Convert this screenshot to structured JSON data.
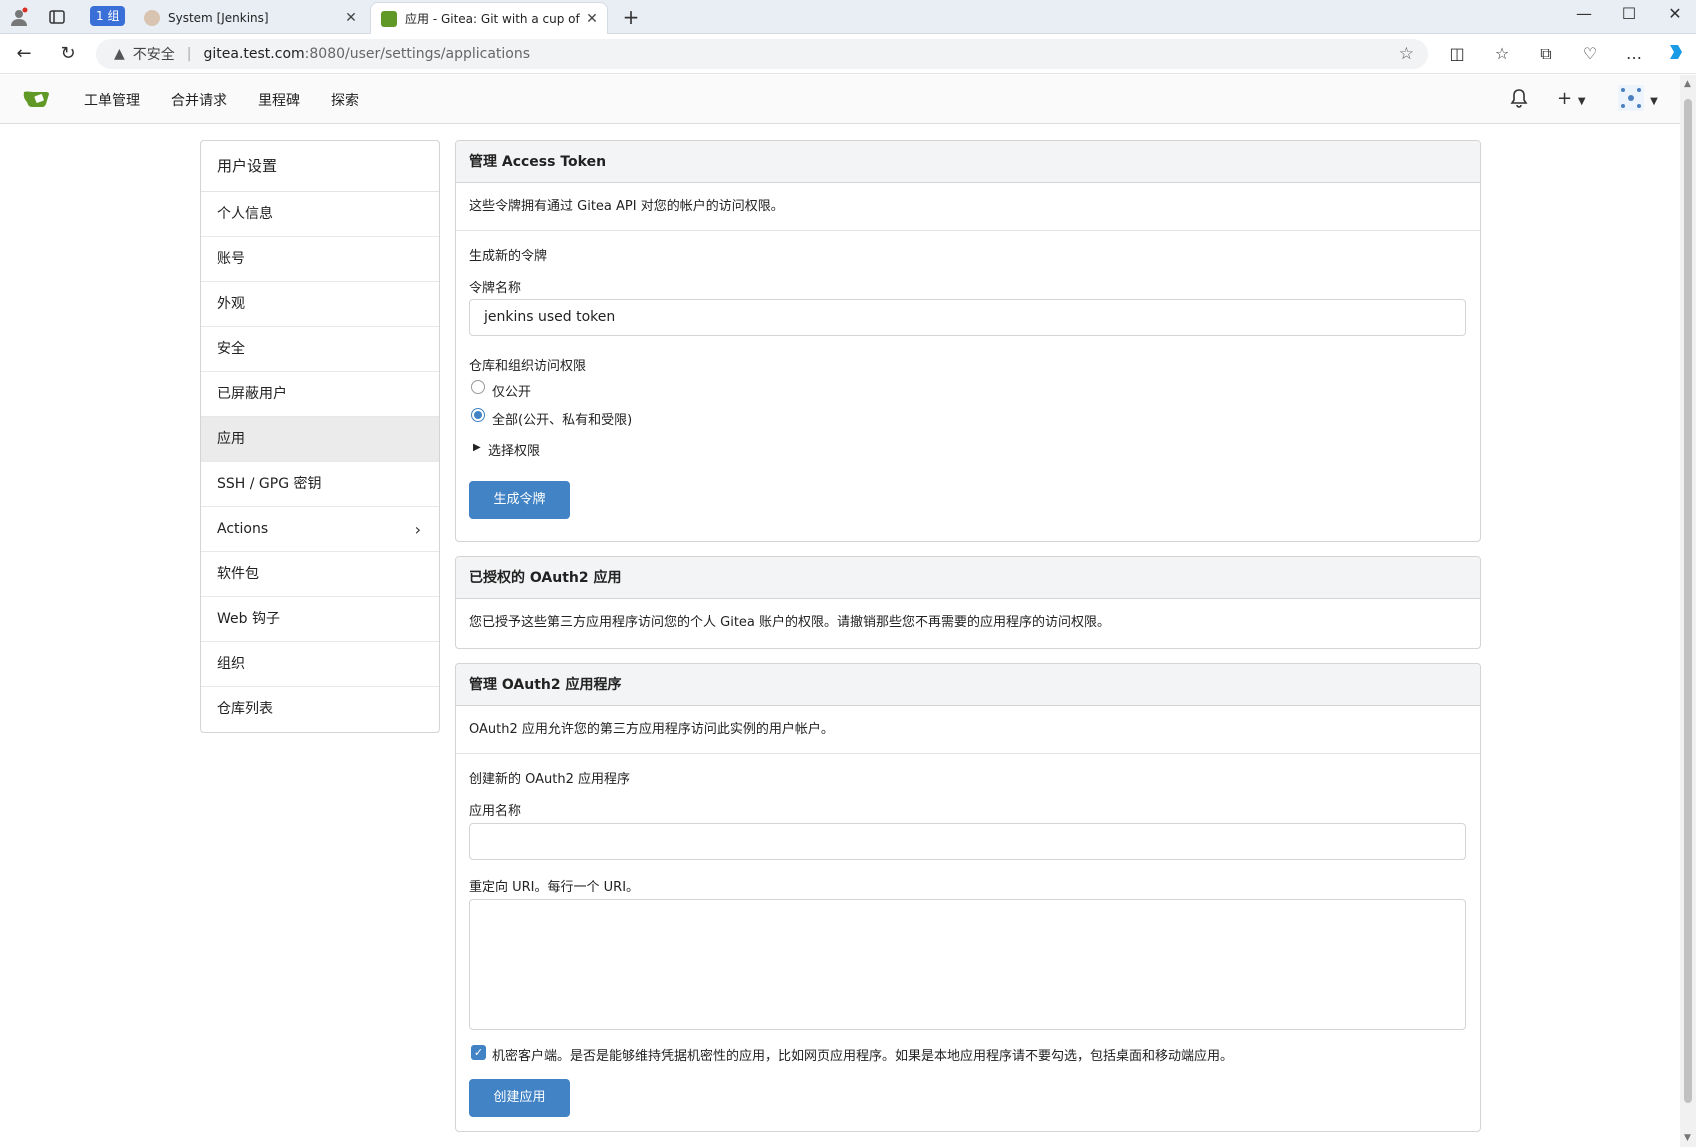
{
  "browser": {
    "group_label": "1 组",
    "tabs": [
      {
        "title": "System [Jenkins]"
      },
      {
        "title": "应用 - Gitea: Git with a cup of tea"
      }
    ],
    "address": {
      "security_label": "不安全",
      "host": "gitea.test.com",
      "path": ":8080/user/settings/applications"
    }
  },
  "navbar": {
    "items": [
      "工单管理",
      "合并请求",
      "里程碑",
      "探索"
    ]
  },
  "sidebar": {
    "header": "用户设置",
    "items": [
      {
        "label": "个人信息"
      },
      {
        "label": "账号"
      },
      {
        "label": "外观"
      },
      {
        "label": "安全"
      },
      {
        "label": "已屏蔽用户"
      },
      {
        "label": "应用",
        "active": true
      },
      {
        "label": "SSH / GPG 密钥"
      },
      {
        "label": "Actions"
      },
      {
        "label": "软件包"
      },
      {
        "label": "Web 钩子"
      },
      {
        "label": "组织"
      },
      {
        "label": "仓库列表"
      }
    ]
  },
  "access_token": {
    "title": "管理 Access Token",
    "description": "这些令牌拥有通过 Gitea API 对您的帐户的访问权限。",
    "generate_heading": "生成新的令牌",
    "name_label": "令牌名称",
    "name_value": "jenkins used token",
    "scope_label": "仓库和组织访问权限",
    "scope_options": [
      "仅公开",
      "全部(公开、私有和受限)"
    ],
    "scope_selected": "全部(公开、私有和受限)",
    "select_permissions": "选择权限",
    "generate_button": "生成令牌"
  },
  "authorized_oauth": {
    "title": "已授权的 OAuth2 应用",
    "description": "您已授予这些第三方应用程序访问您的个人 Gitea 账户的权限。请撤销那些您不再需要的应用程序的访问权限。"
  },
  "oauth_apps": {
    "title": "管理 OAuth2 应用程序",
    "description": "OAuth2 应用允许您的第三方应用程序访问此实例的用户帐户。",
    "create_heading": "创建新的 OAuth2 应用程序",
    "app_name_label": "应用名称",
    "app_name_value": "",
    "redirect_label": "重定向 URI。每行一个 URI。",
    "redirect_value": "",
    "confidential_checked": true,
    "confidential_label": "机密客户端。是否是能够维持凭据机密性的应用，比如网页应用程序。如果是本地应用程序请不要勾选，包括桌面和移动端应用。",
    "create_button": "创建应用"
  },
  "colors": {
    "primary": "#4183c4",
    "gitea_green": "#609926"
  }
}
